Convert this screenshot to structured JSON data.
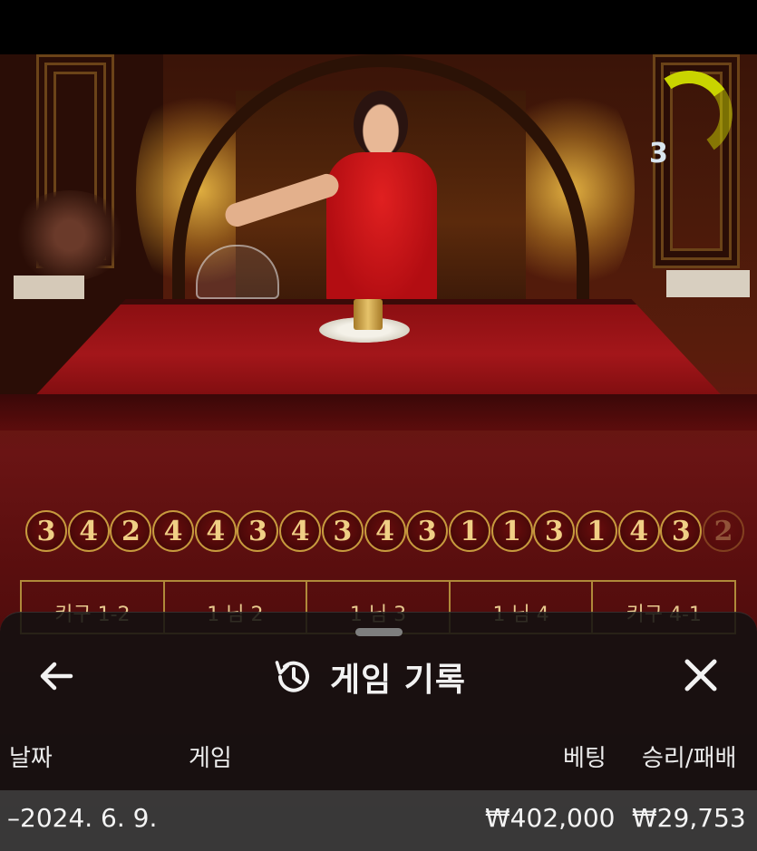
{
  "video": {
    "timer_value": "3",
    "road_results": [
      "3",
      "4",
      "2",
      "4",
      "4",
      "3",
      "4",
      "3",
      "4",
      "3",
      "1",
      "1",
      "3",
      "1",
      "4",
      "3",
      "2"
    ],
    "bet_labels": [
      "키구 1-2",
      "1 님 2",
      "1 님 3",
      "1 님 4",
      "키구 4-1"
    ]
  },
  "history_panel": {
    "title": "게임 기록",
    "icons": {
      "back": "arrow-left-icon",
      "history": "history-clock-icon",
      "close": "close-icon"
    },
    "columns": {
      "date": "날짜",
      "game": "게임",
      "bet": "베팅",
      "win_loss": "승리/패배"
    },
    "rows": [
      {
        "date": "–2024. 6. 9.",
        "game": "",
        "bet": "₩402,000",
        "win_loss": "₩29,753"
      }
    ]
  },
  "colors": {
    "accent_gold": "#c79a3e",
    "timer": "#c9d400",
    "panel_bg": "#121212"
  }
}
